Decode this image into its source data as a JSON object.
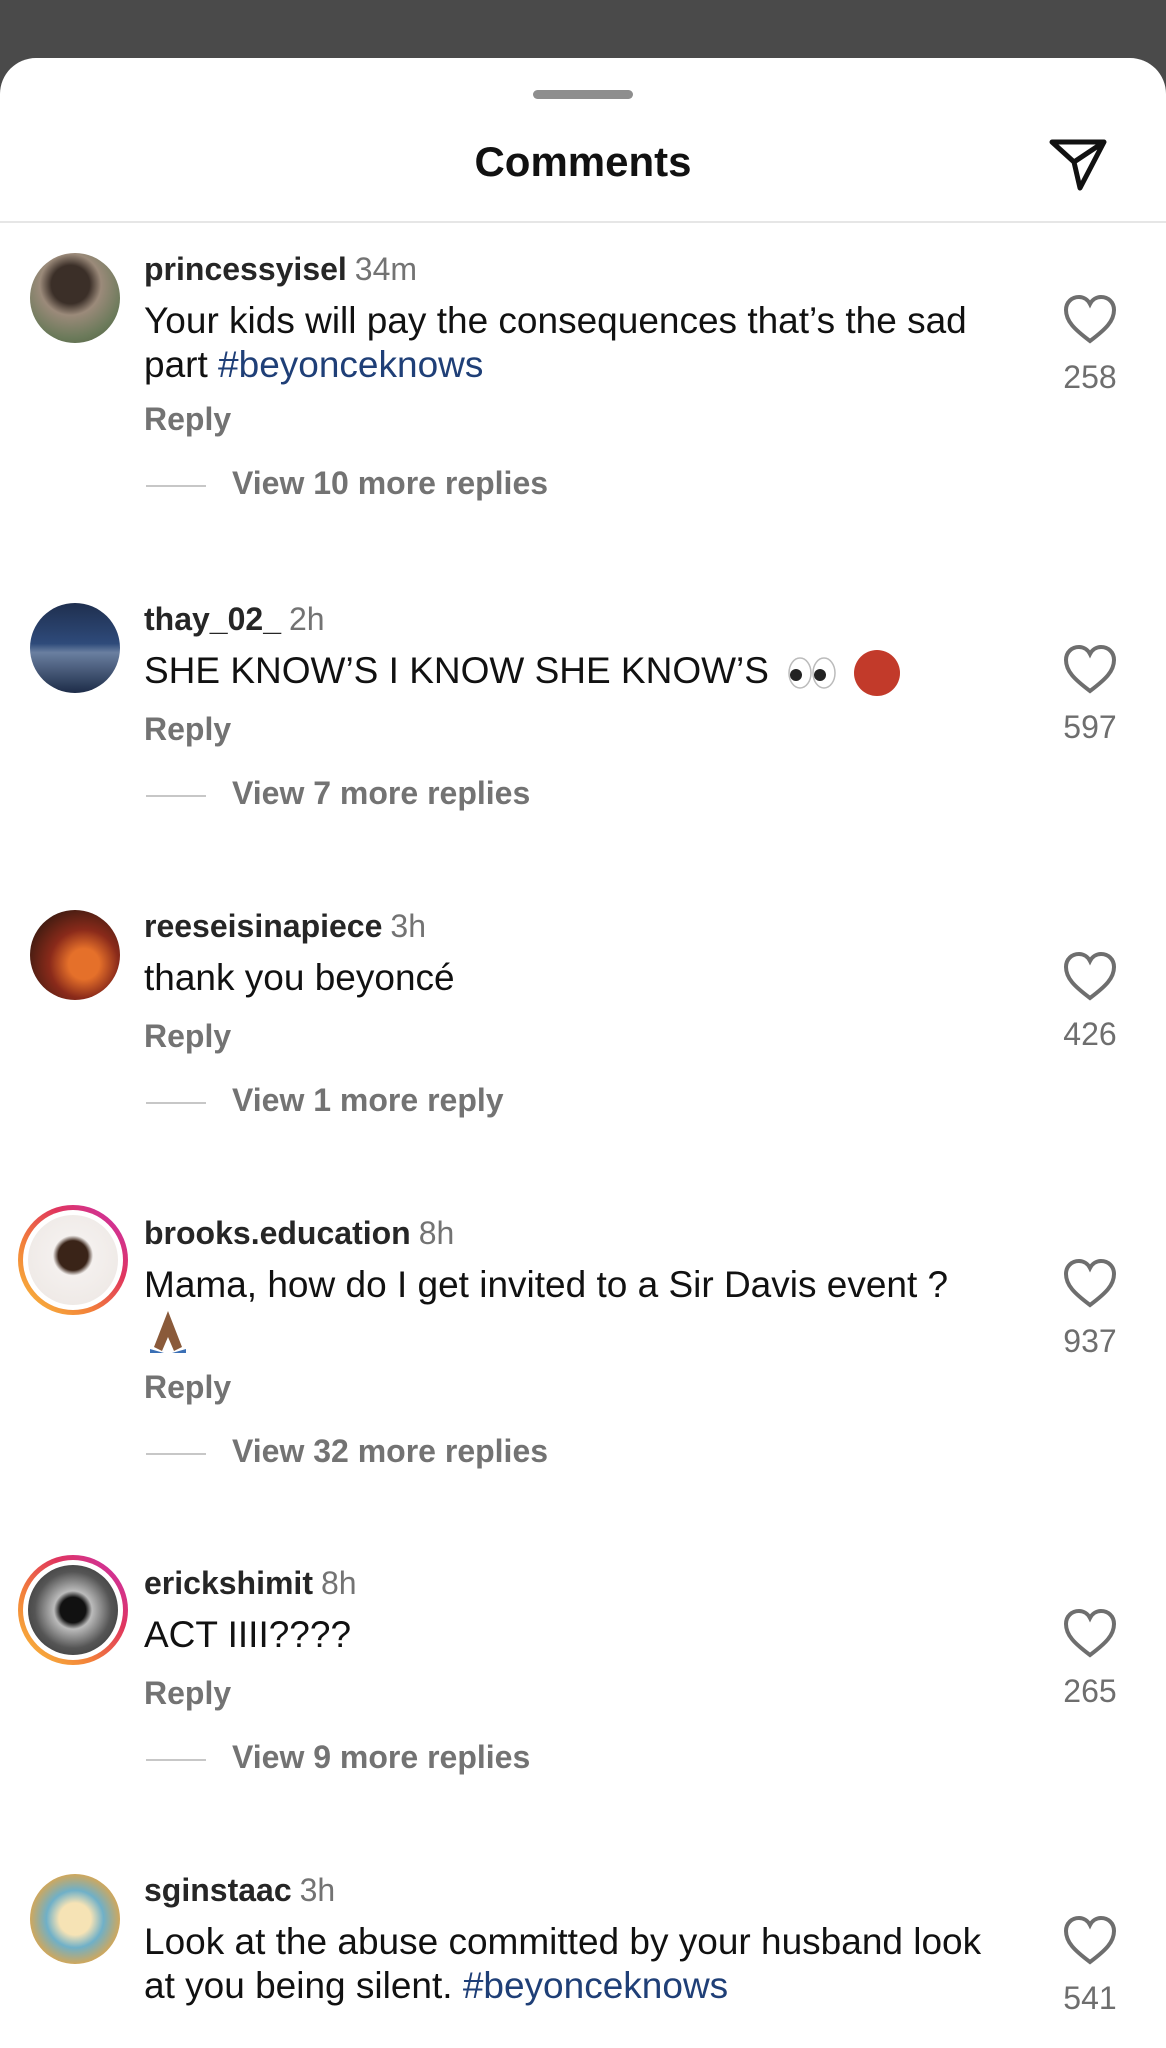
{
  "header": {
    "title": "Comments",
    "send_icon": "paper-plane-icon"
  },
  "comments": [
    {
      "username": "princessyisel",
      "time": "34m",
      "text_before": "Your kids will pay the consequences that’s the sad part ",
      "hashtag": "#beyonceknows",
      "reply_label": "Reply",
      "more_label": "View 10 more replies",
      "likes": "258",
      "avatar_color": "#6b5b4a"
    },
    {
      "username": "thay_02_",
      "time": "2h",
      "text_before": "SHE KNOW’S I KNOW SHE KNOW’S",
      "emojis": "eyes-emoji ogre-emoji",
      "reply_label": "Reply",
      "more_label": "View 7 more replies",
      "likes": "597",
      "avatar_color": "#3d5a8a"
    },
    {
      "username": "reeseisinapiece",
      "time": "3h",
      "text_before": "thank you beyoncé",
      "reply_label": "Reply",
      "more_label": "View 1 more reply",
      "likes": "426",
      "avatar_color": "#b5542d"
    },
    {
      "username": "brooks.education",
      "time": "8h",
      "text_before": "Mama, how do I get invited to a Sir Davis event ?",
      "emojis": "folded-hands-emoji",
      "reply_label": "Reply",
      "more_label": "View 32 more replies",
      "likes": "937",
      "avatar_color": "#f2efee"
    },
    {
      "username": "erickshimit",
      "time": "8h",
      "text_before": "ACT IIII????",
      "reply_label": "Reply",
      "more_label": "View 9 more replies",
      "likes": "265",
      "avatar_color": "#2a2a2a"
    },
    {
      "username": "sginstaac",
      "time": "3h",
      "text_before": "Look at the abuse committed by your husband look at you being silent. ",
      "hashtag": "#beyonceknows",
      "likes": "541",
      "avatar_color": "#e0a64a"
    }
  ]
}
